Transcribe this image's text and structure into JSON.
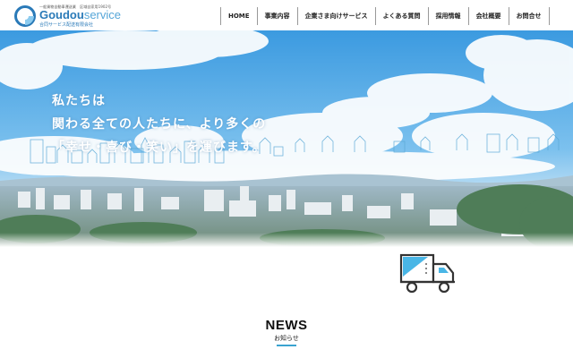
{
  "header": {
    "logo": {
      "tagline": "一般貨物自動車運送業　区域自家用1902号",
      "name_bold": "Goudou",
      "name_light": "service",
      "company": "合同サービス配送有限会社",
      "brand_color": "#2a7ab8"
    },
    "nav": [
      {
        "label": "HOME"
      },
      {
        "label": "事業内容"
      },
      {
        "label": "企業さま向けサービス"
      },
      {
        "label": "よくある質問"
      },
      {
        "label": "採用情報"
      },
      {
        "label": "会社概要"
      },
      {
        "label": "お問合せ"
      }
    ]
  },
  "hero": {
    "lines": [
      "私たちは",
      "関わる全ての人たちに、より多くの",
      "「幸せ・喜び・笑い」を運びます。"
    ],
    "sky_color": "#4aa3e0"
  },
  "truck_icon": "delivery-truck-icon",
  "news": {
    "title": "NEWS",
    "subtitle": "お知らせ",
    "accent": "#3aa3d0"
  }
}
